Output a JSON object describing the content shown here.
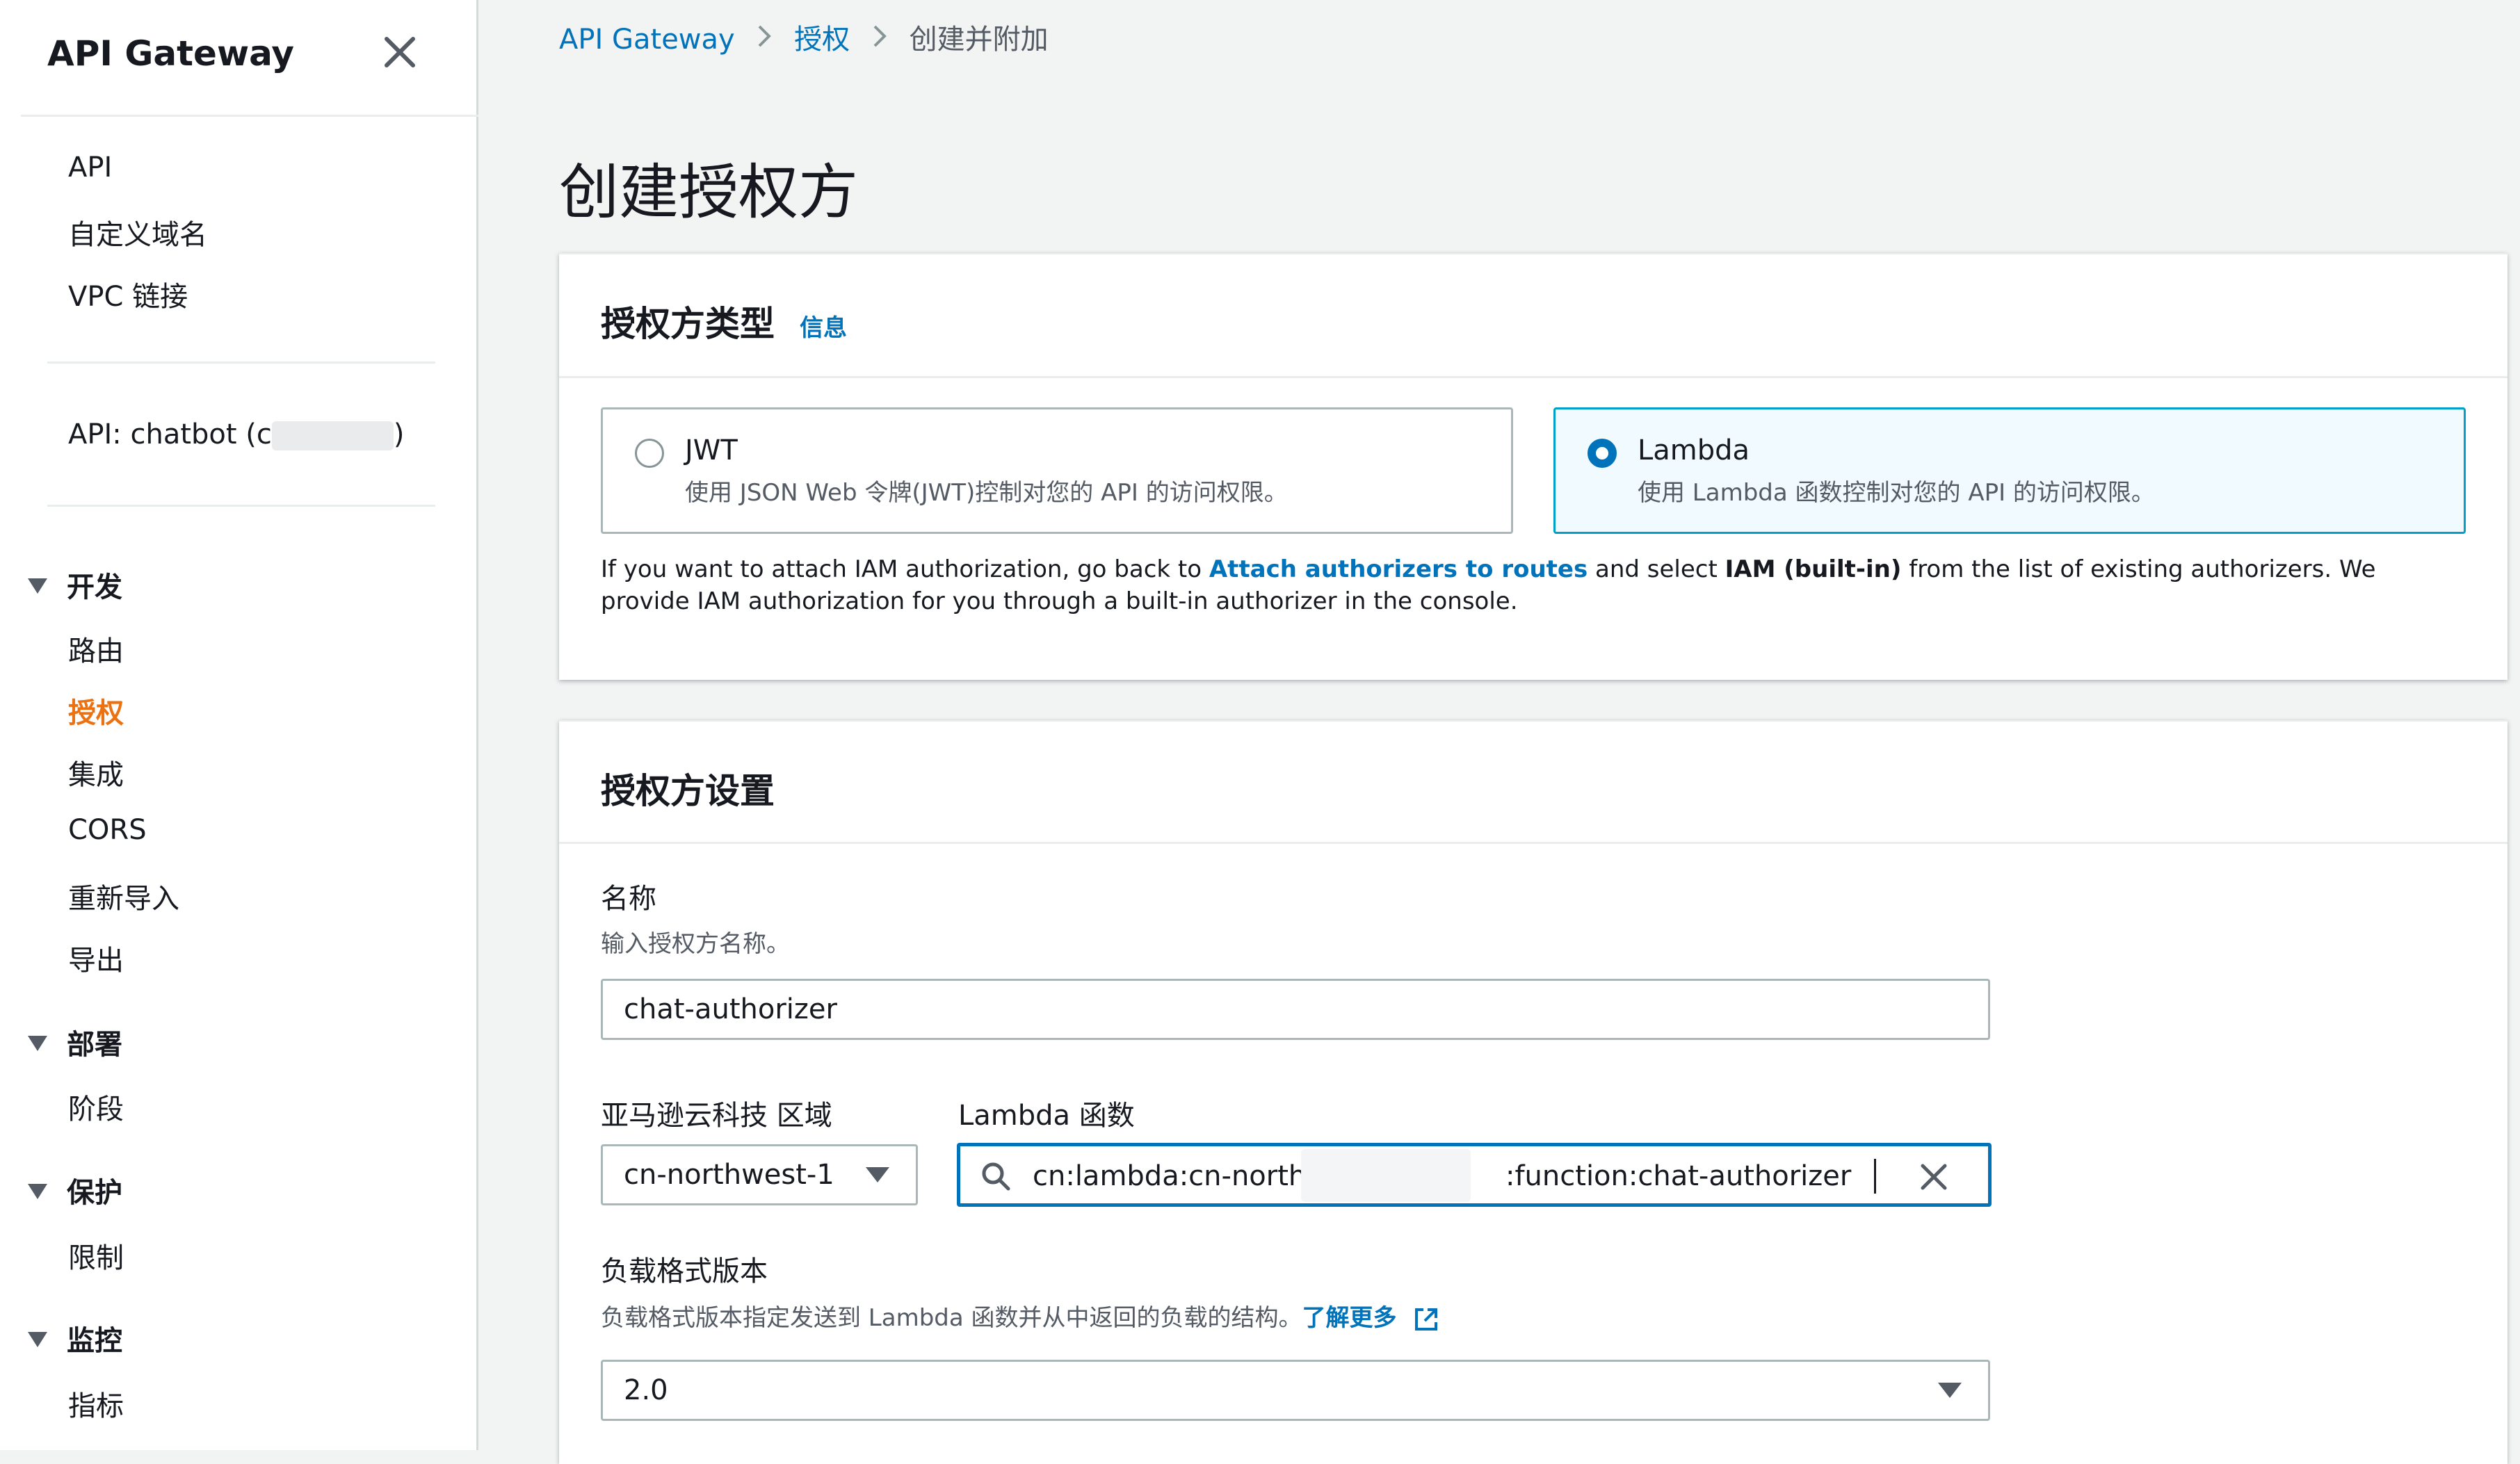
{
  "sidebar": {
    "title": "API Gateway",
    "top_links": [
      "API",
      "自定义域名",
      "VPC 链接"
    ],
    "api_label_prefix": "API: chatbot (c",
    "api_label_suffix": ")",
    "sections": [
      {
        "title": "开发",
        "items": [
          "路由",
          "授权",
          "集成",
          "CORS",
          "重新导入",
          "导出"
        ]
      },
      {
        "title": "部署",
        "items": [
          "阶段"
        ]
      },
      {
        "title": "保护",
        "items": [
          "限制"
        ]
      },
      {
        "title": "监控",
        "items": [
          "指标"
        ]
      }
    ],
    "active_item": "授权",
    "close_icon": "close-icon",
    "section_icon": "caret-down-icon"
  },
  "breadcrumb": {
    "items": [
      "API Gateway",
      "授权",
      "创建并附加"
    ]
  },
  "page_title": "创建授权方",
  "authorizer_type": {
    "title": "授权方类型",
    "info": "信息",
    "options": [
      {
        "label": "JWT",
        "description": "使用 JSON Web 令牌(JWT)控制对您的 API 的访问权限。",
        "selected": false
      },
      {
        "label": "Lambda",
        "description": "使用 Lambda 函数控制对您的 API 的访问权限。",
        "selected": true
      }
    ],
    "note_prefix": "If you want to attach IAM authorization, go back to ",
    "note_link": "Attach authorizers to routes",
    "note_mid": " and select ",
    "note_bold": "IAM (built-in)",
    "note_suffix": " from the list of existing authorizers. We provide IAM authorization for you through a built-in authorizer in the console."
  },
  "settings": {
    "title": "授权方设置",
    "name_label": "名称",
    "name_desc": "输入授权方名称。",
    "name_value": "chat-authorizer",
    "region_label": "亚马逊云科技 区域",
    "region_value": "cn-northwest-1",
    "lambda_label": "Lambda 函数",
    "lambda_value_left": "cn:lambda:cn-northwest-1:76",
    "lambda_value_right": ":function:chat-authorizer",
    "payload_label": "负载格式版本",
    "payload_desc": "负载格式版本指定发送到 Lambda 函数并从中返回的负载的结构。",
    "learn_more": "了解更多",
    "payload_value": "2.0"
  },
  "colors": {
    "accent": "#0073bb",
    "active_nav": "#ec7211",
    "selected_tile_border": "#00a1c9"
  }
}
